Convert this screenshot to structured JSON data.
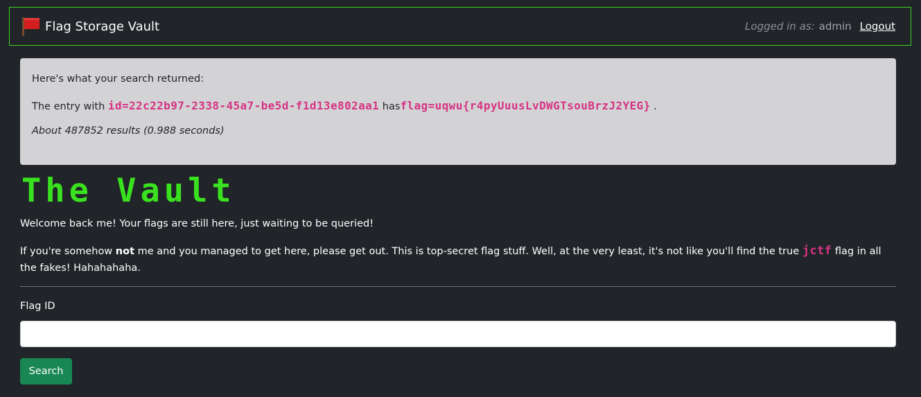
{
  "navbar": {
    "brand": "Flag Storage Vault",
    "brand_icon": "red-flag-icon",
    "logged_in_label": "Logged in as:",
    "username": "admin",
    "logout_label": "Logout",
    "border_color": "#3ad31f"
  },
  "result": {
    "heading": "Here's what your search returned:",
    "prefix": "The entry with",
    "id_text": "id=22c22b97-2338-45a7-be5d-f1d13e802aa1",
    "connector": "has",
    "flag_text": "flag=uqwu{r4pyUuusLvDWGTsouBrzJ2YEG}",
    "suffix": ".",
    "stats": "About 487852 results (0.988 seconds)"
  },
  "main": {
    "title": "The Vault",
    "welcome": "Welcome back me! Your flags are still here, just waiting to be queried!",
    "warning_pre": "If you're somehow",
    "warning_bold": "not",
    "warning_mid": "me and you managed to get here, please get out. This is top-secret flag stuff. Well, at the very least, it's not like you'll find the true",
    "warning_code": "jctf",
    "warning_post": "flag in all the fakes! Hahahahaha."
  },
  "form": {
    "label": "Flag ID",
    "input_value": "",
    "button_label": "Search"
  },
  "colors": {
    "background": "#212529",
    "accent_green": "#3ae11e",
    "code_pink": "#d63384",
    "button_green": "#198754"
  }
}
